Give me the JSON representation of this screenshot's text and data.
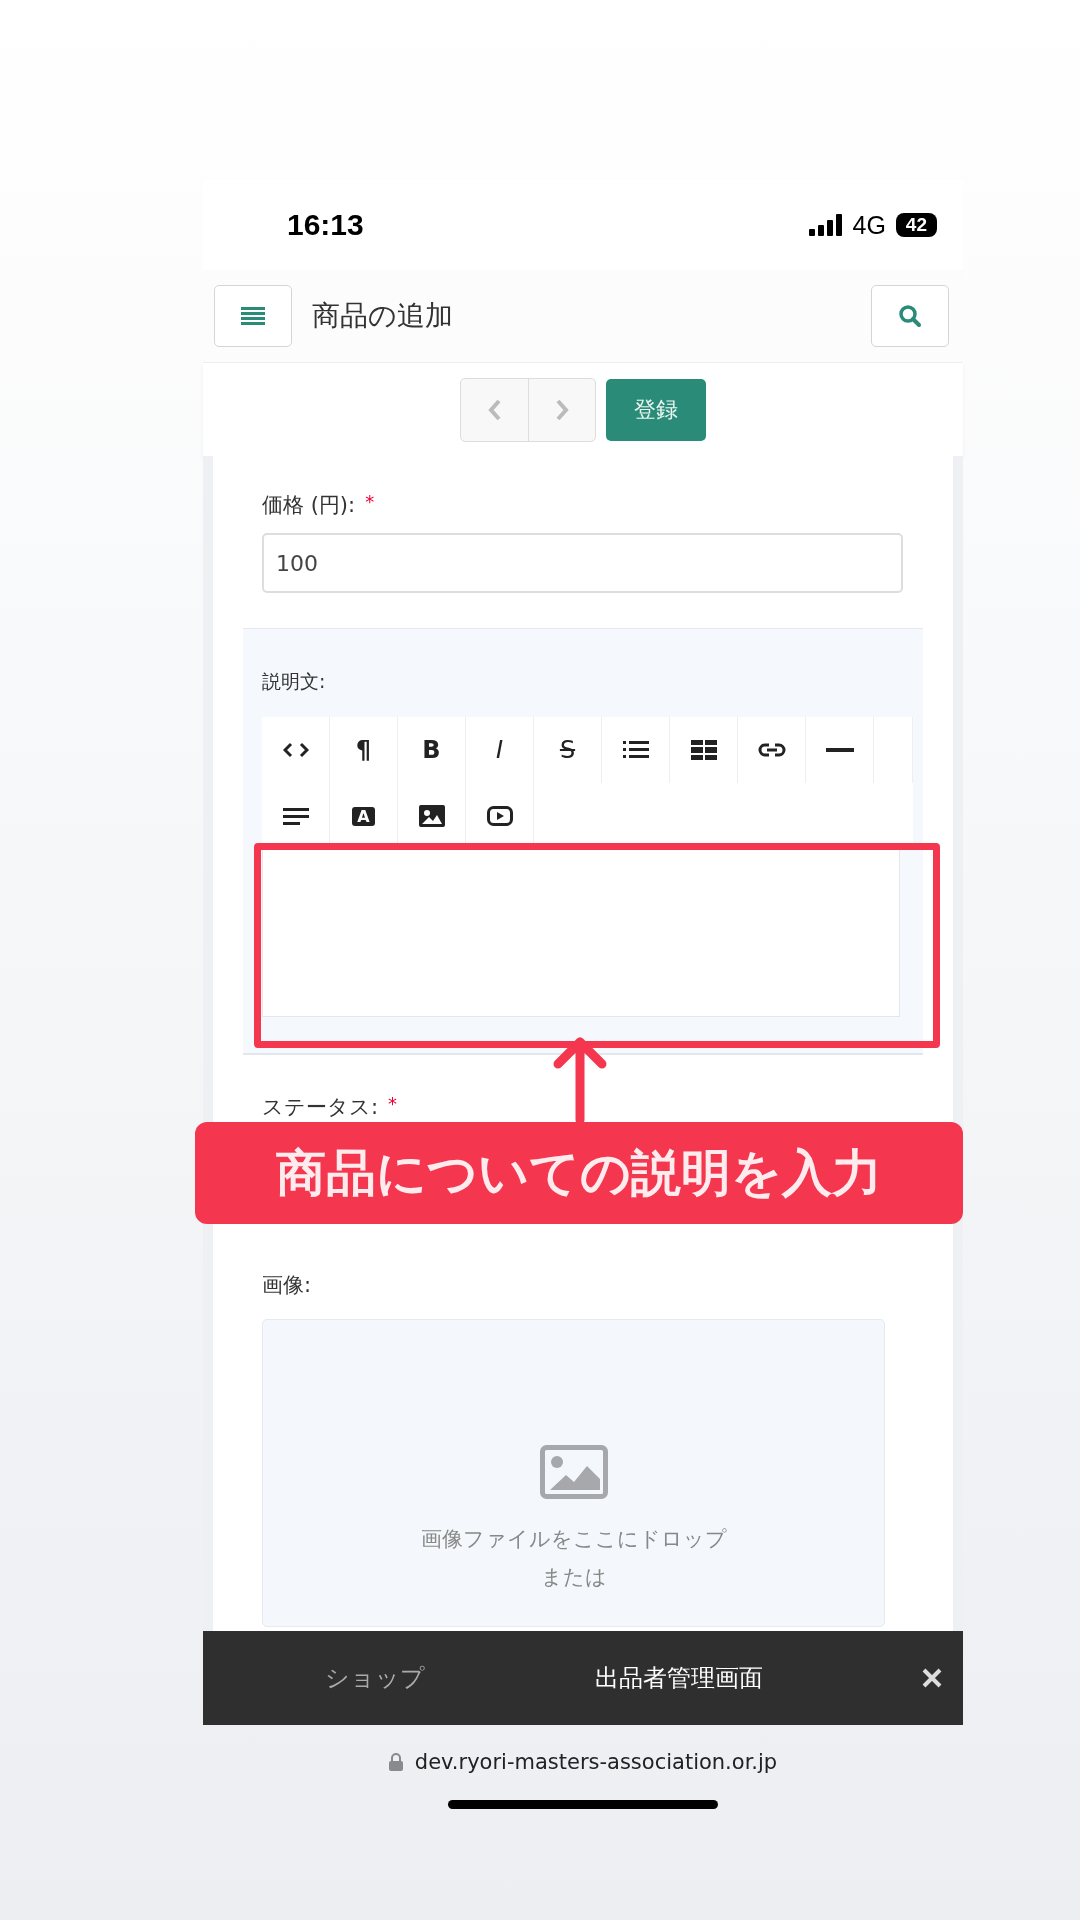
{
  "status_bar": {
    "time": "16:13",
    "network": "4G",
    "battery": "42"
  },
  "header": {
    "title": "商品の追加"
  },
  "toolbar": {
    "submit": "登録"
  },
  "form": {
    "price": {
      "label": "価格 (円):",
      "required_mark": "*",
      "value": "100"
    },
    "description": {
      "label": "説明文:",
      "tools": [
        {
          "kind": "code"
        },
        {
          "kind": "glyph",
          "label": "¶"
        },
        {
          "kind": "glyph",
          "label": "B"
        },
        {
          "kind": "italic",
          "label": "I"
        },
        {
          "kind": "strike",
          "label": "S"
        },
        {
          "kind": "list"
        },
        {
          "kind": "table"
        },
        {
          "kind": "link"
        },
        {
          "kind": "rule"
        },
        {
          "kind": "align"
        },
        {
          "kind": "boxed",
          "label": "A"
        },
        {
          "kind": "image"
        },
        {
          "kind": "video"
        }
      ]
    },
    "status": {
      "label": "ステータス:",
      "required_mark": "*"
    },
    "image": {
      "label": "画像:",
      "drop_text": "画像ファイルをここにドロップ",
      "or_text": "または"
    }
  },
  "annotation": {
    "text": "商品についての説明を入力"
  },
  "bottom_bar": {
    "tabs": [
      {
        "label": "ショップ",
        "selected": false
      },
      {
        "label": "出品者管理画面",
        "selected": true
      }
    ]
  },
  "url": "dev.ryori-masters-association.or.jp"
}
